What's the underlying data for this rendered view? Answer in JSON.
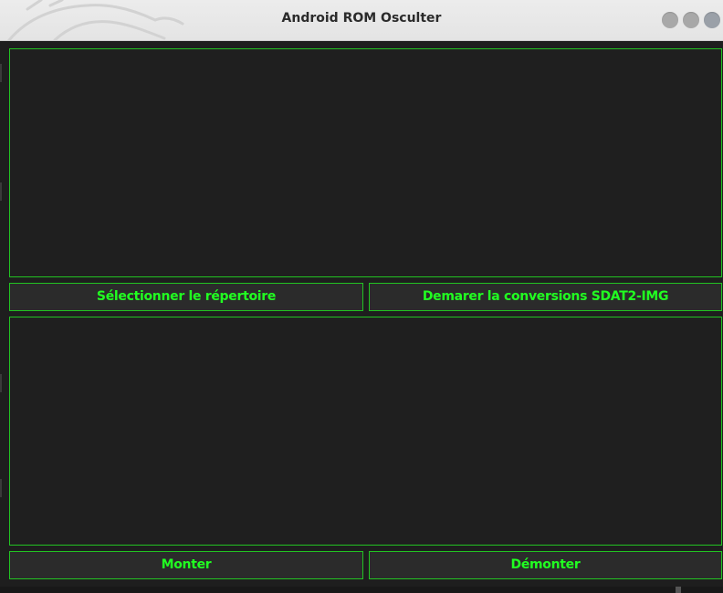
{
  "window": {
    "title": "Android ROM Osculter"
  },
  "top_output": {
    "text": ""
  },
  "bottom_output": {
    "text": ""
  },
  "buttons": {
    "select_dir": "Sélectionner le répertoire",
    "start_conversion": "Demarer la conversions SDAT2-IMG",
    "mount": "Monter",
    "unmount": "Démonter"
  },
  "colors": {
    "accent": "#21ff21",
    "border": "#22c322",
    "background": "#1e1e1e",
    "button_bg": "#2b2b2b"
  }
}
